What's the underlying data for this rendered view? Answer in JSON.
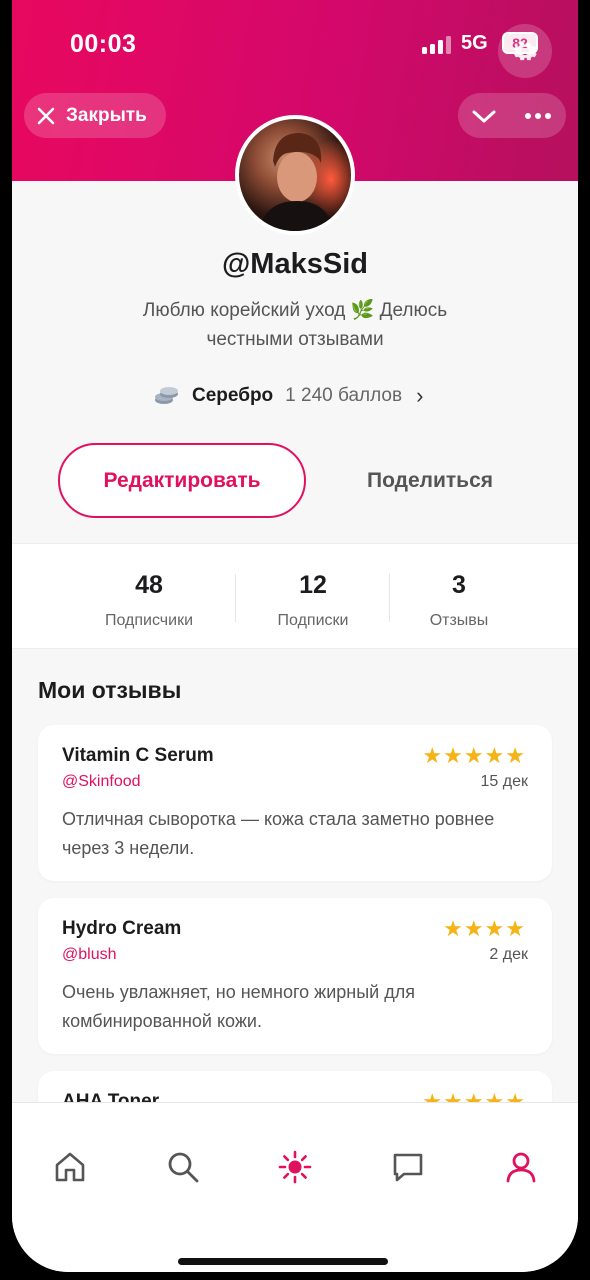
{
  "status_bar": {
    "time": "00:03",
    "network": "5G",
    "battery": "82"
  },
  "header": {
    "close_label": "Закрыть"
  },
  "profile": {
    "username": "@MaksSid",
    "bio": "Люблю корейский уход 🌿 Делюсь честными отзывами",
    "level_name": "Серебро",
    "level_points": "1 240 баллов"
  },
  "actions": {
    "edit_label": "Редактировать",
    "share_label": "Поделиться"
  },
  "stats": [
    {
      "value": "48",
      "label": "Подписчики"
    },
    {
      "value": "12",
      "label": "Подписки"
    },
    {
      "value": "3",
      "label": "Отзывы"
    }
  ],
  "reviews_section": {
    "title": "Мои отзывы",
    "items": [
      {
        "title": "Vitamin C Serum",
        "brand": "@Skinfood",
        "stars": "★★★★★",
        "rating": 5,
        "date": "15 дек",
        "text": "Отличная сыворотка — кожа стала заметно ровнее через 3 недели."
      },
      {
        "title": "Hydro Cream",
        "brand": "@blush",
        "stars": "★★★★",
        "rating": 4,
        "date": "2 дек",
        "text": "Очень увлажняет, но немного жирный для комбинированной кожи."
      },
      {
        "title": "AHA Toner",
        "brand": "",
        "stars": "★★★★★",
        "rating": 5,
        "date": "",
        "text": ""
      }
    ]
  },
  "tabbar": {
    "items": [
      "home-icon",
      "search-icon",
      "sun-icon",
      "chat-icon",
      "profile-icon"
    ],
    "active": "profile-icon"
  },
  "colors": {
    "accent": "#e0115f",
    "header_start": "#e8085f",
    "header_end": "#b5105e",
    "star": "#f5b315"
  }
}
